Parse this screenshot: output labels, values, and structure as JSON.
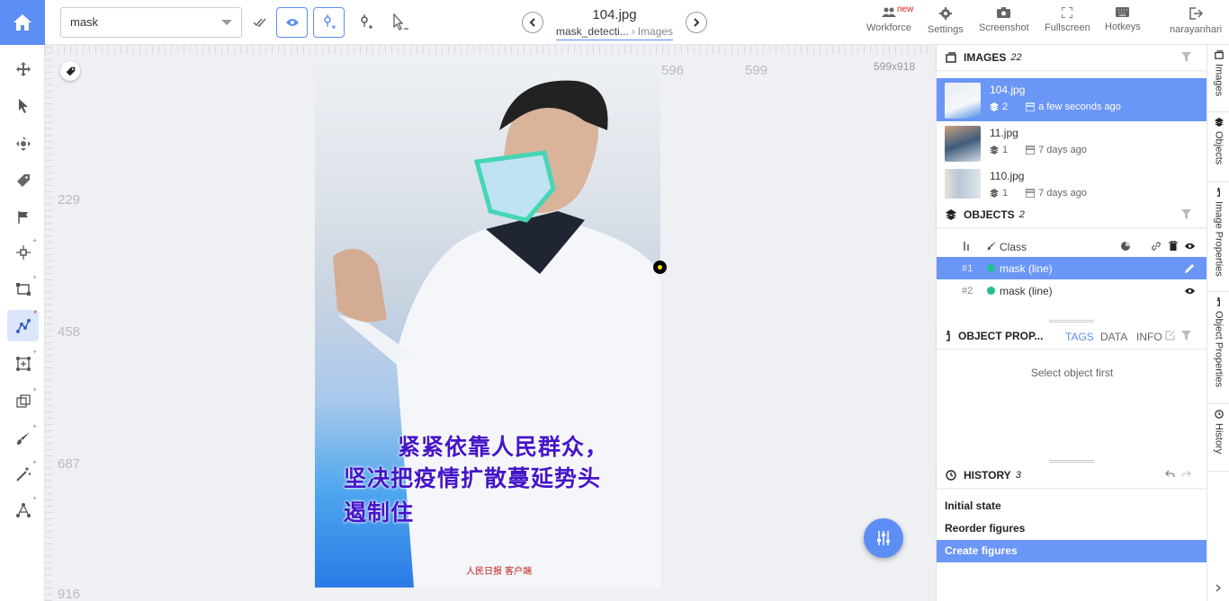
{
  "toolbar": {
    "class_value": "mask",
    "file_name": "104.jpg",
    "breadcrumb_project": "mask_detecti...",
    "breadcrumb_section": "Images",
    "actions": [
      {
        "label": "Workforce",
        "icon": "workforce-icon"
      },
      {
        "label": "Settings",
        "icon": "gear-icon"
      },
      {
        "label": "Screenshot",
        "icon": "camera-icon"
      },
      {
        "label": "Fullscreen",
        "icon": "fullscreen-icon"
      },
      {
        "label": "Hotkeys",
        "icon": "keyboard-icon"
      },
      {
        "label": "narayanhari",
        "icon": "logout-icon"
      }
    ],
    "new_badge": "new"
  },
  "canvas": {
    "ruler_numbers": [
      "596",
      "599",
      "229",
      "458",
      "687",
      "916"
    ],
    "dimensions": "599x918",
    "poster_line1": "紧紧依靠人民群众，",
    "poster_line2": "坚决把疫情扩散蔓延势头",
    "poster_line3": "遏制住",
    "poster_logo": "人民日报 客户端"
  },
  "images_panel": {
    "title": "IMAGES",
    "count": "22",
    "items": [
      {
        "name": "104.jpg",
        "objects": "2",
        "time": "a few seconds ago"
      },
      {
        "name": "11.jpg",
        "objects": "1",
        "time": "7 days ago"
      },
      {
        "name": "110.jpg",
        "objects": "1",
        "time": "7 days ago"
      }
    ]
  },
  "objects_panel": {
    "title": "OBJECTS",
    "count": "2",
    "column_class": "Class",
    "items": [
      {
        "num": "1",
        "name": "mask (line)"
      },
      {
        "num": "2",
        "name": "mask (line)"
      }
    ]
  },
  "props_panel": {
    "title": "OBJECT PROP...",
    "tabs": [
      "TAGS",
      "DATA",
      "INFO"
    ],
    "empty_text": "Select object first"
  },
  "history_panel": {
    "title": "HISTORY",
    "count": "3",
    "items": [
      "Initial state",
      "Reorder figures",
      "Create figures"
    ]
  },
  "side_tabs": [
    "Images",
    "Objects",
    "Image Properties",
    "Object Properties",
    "History"
  ],
  "colors": {
    "accent": "#5d8ef5",
    "selected_row": "#6a96f6",
    "mask_class": "#1fbf8f"
  }
}
